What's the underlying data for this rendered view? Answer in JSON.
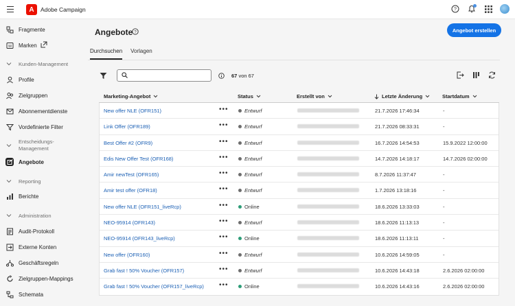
{
  "app": {
    "title": "Adobe Campaign",
    "logo_letter": "A"
  },
  "sidebar": {
    "items_top": [
      {
        "label": "Fragmente",
        "icon": "fragment-icon"
      },
      {
        "label": "Marken",
        "icon": "brand-icon"
      }
    ],
    "section_customer": {
      "label": "Kunden-Management"
    },
    "items_customer": [
      {
        "label": "Profile",
        "icon": "person-icon"
      },
      {
        "label": "Zielgruppen",
        "icon": "people-icon"
      },
      {
        "label": "Abonnementdienste",
        "icon": "subscription-icon"
      },
      {
        "label": "Vordefinierte Filter",
        "icon": "filter-icon"
      }
    ],
    "section_decision": {
      "label": "Entscheidungs-\nManagement",
      "line1": "Entscheidungs-",
      "line2": "Management"
    },
    "items_decision": [
      {
        "label": "Angebote",
        "icon": "offer-icon",
        "active": true
      }
    ],
    "section_reporting": {
      "label": "Reporting"
    },
    "items_reporting": [
      {
        "label": "Berichte",
        "icon": "chart-icon"
      }
    ],
    "section_admin": {
      "label": "Administration"
    },
    "items_admin": [
      {
        "label": "Audit-Protokoll",
        "icon": "audit-icon"
      },
      {
        "label": "Externe Konten",
        "icon": "external-account-icon"
      },
      {
        "label": "Geschäftsregeln",
        "icon": "rules-icon"
      },
      {
        "label": "Zielgruppen-Mappings",
        "icon": "mapping-icon"
      },
      {
        "label": "Schemata",
        "icon": "schema-icon"
      }
    ]
  },
  "page": {
    "title": "Angebote",
    "create_button": "Angebot erstellen",
    "tabs": [
      {
        "label": "Durchsuchen",
        "active": true
      },
      {
        "label": "Vorlagen",
        "active": false
      }
    ],
    "search": {
      "value": "",
      "placeholder": ""
    },
    "count_current": "67",
    "count_of": "von 67"
  },
  "table": {
    "columns": {
      "name": "Marketing-Angebot",
      "status": "Status",
      "creator": "Erstellt von",
      "modified": "Letzte Änderung",
      "start": "Startdatum"
    },
    "rows": [
      {
        "name": "New offer NLE (OFR151)",
        "status": "Entwurf",
        "modified": "21.7.2026 17:46:34",
        "start": "-"
      },
      {
        "name": "Link Offer (OFR189)",
        "status": "Entwurf",
        "modified": "21.7.2026 08:33:31",
        "start": "-"
      },
      {
        "name": "Best Offer #2 (OFR9)",
        "status": "Entwurf",
        "modified": "16.7.2026 14:54:53",
        "start": "15.9.2022 12:00:00"
      },
      {
        "name": "Edis New Offer Test (OFR168)",
        "status": "Entwurf",
        "modified": "14.7.2026 14:18:17",
        "start": "14.7.2026 02:00:00"
      },
      {
        "name": "Amir newTest (OFR165)",
        "status": "Entwurf",
        "modified": "8.7.2026 11:37:47",
        "start": "-"
      },
      {
        "name": "Amir test offer (OFR18)",
        "status": "Entwurf",
        "modified": "1.7.2026 13:18:16",
        "start": "-"
      },
      {
        "name": "New offer NLE (OFR151_liveRcp)",
        "status": "Online",
        "modified": "18.6.2026 13:33:03",
        "start": "-"
      },
      {
        "name": "NEO-95914 (OFR143)",
        "status": "Entwurf",
        "modified": "18.6.2026 11:13:13",
        "start": "-"
      },
      {
        "name": "NEO-95914 (OFR143_liveRcp)",
        "status": "Online",
        "modified": "18.6.2026 11:13:11",
        "start": "-"
      },
      {
        "name": "New offer (OFR160)",
        "status": "Entwurf",
        "modified": "10.6.2026 14:59:05",
        "start": "-"
      },
      {
        "name": "Grab fast ! 50% Voucher (OFR157)",
        "status": "Entwurf",
        "modified": "10.6.2026 14:43:18",
        "start": "2.6.2026 02:00:00"
      },
      {
        "name": "Grab fast ! 50% Voucher (OFR157_liveRcp)",
        "status": "Online",
        "modified": "10.6.2026 14:43:16",
        "start": "2.6.2026 02:00:00"
      }
    ],
    "row_action": "•••"
  },
  "colors": {
    "accent": "#1473e6",
    "draft": "#6e6e6e",
    "online": "#2d9d78",
    "link": "#1a5fb4"
  }
}
